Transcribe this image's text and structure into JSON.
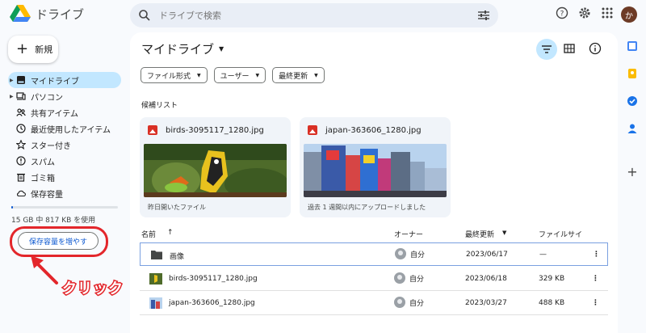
{
  "app": {
    "title": "ドライブ"
  },
  "search": {
    "placeholder": "ドライブで検索"
  },
  "user": {
    "avatar_initial": "か"
  },
  "sidebar": {
    "new_label": "新規",
    "items": [
      {
        "label": "マイドライブ",
        "icon": "my-drive-icon",
        "active": true
      },
      {
        "label": "パソコン",
        "icon": "computers-icon"
      },
      {
        "label": "共有アイテム",
        "icon": "shared-icon"
      },
      {
        "label": "最近使用したアイテム",
        "icon": "clock-icon"
      },
      {
        "label": "スター付き",
        "icon": "star-icon"
      },
      {
        "label": "スパム",
        "icon": "spam-icon"
      },
      {
        "label": "ゴミ箱",
        "icon": "trash-icon"
      },
      {
        "label": "保存容量",
        "icon": "cloud-icon"
      }
    ],
    "storage_text": "15 GB 中 817 KB を使用",
    "storage_used_fraction": 5e-05,
    "storage_button": "保存容量を増やす"
  },
  "annotation": {
    "text": "クリック",
    "color": "#e3262b"
  },
  "main": {
    "title": "マイドライブ",
    "filters": [
      "ファイル形式",
      "ユーザー",
      "最終更新"
    ],
    "suggest_label": "候補リスト",
    "cards": [
      {
        "name": "birds-3095117_1280.jpg",
        "footer": "昨日開いたファイル"
      },
      {
        "name": "japan-363606_1280.jpg",
        "footer": "過去 1 週間以内にアップロードしました"
      }
    ],
    "table": {
      "headers": {
        "name": "名前",
        "owner": "オーナー",
        "modified": "最終更新",
        "size": "ファイルサイ"
      },
      "rows": [
        {
          "name": "画像",
          "owner": "自分",
          "modified": "2023/06/17",
          "size": "—",
          "type": "folder"
        },
        {
          "name": "birds-3095117_1280.jpg",
          "owner": "自分",
          "modified": "2023/06/18",
          "size": "329 KB",
          "type": "image"
        },
        {
          "name": "japan-363606_1280.jpg",
          "owner": "自分",
          "modified": "2023/03/27",
          "size": "488 KB",
          "type": "image"
        }
      ]
    }
  },
  "colors": {
    "accent": "#0b57d0",
    "active_bg": "#c2e7ff",
    "panel_bg": "#ffffff",
    "page_bg": "#f8fafd"
  }
}
